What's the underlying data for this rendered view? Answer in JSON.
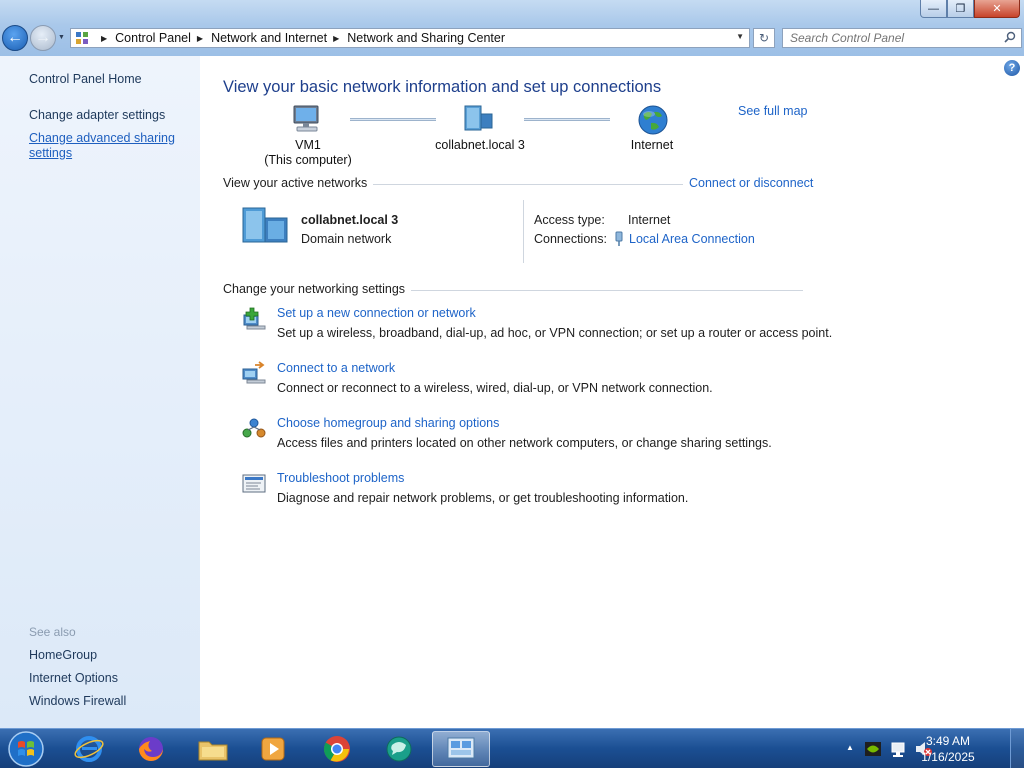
{
  "window": {
    "minimize_glyph": "—",
    "maximize_glyph": "❐",
    "close_glyph": "✕"
  },
  "toolbar": {
    "back_glyph": "←",
    "forward_glyph": "→",
    "breadcrumbs": [
      "Control Panel",
      "Network and Internet",
      "Network and Sharing Center"
    ],
    "refresh_glyph": "↻",
    "search_placeholder": "Search Control Panel"
  },
  "sidebar": {
    "home": "Control Panel Home",
    "adapter": "Change adapter settings",
    "advanced_line1": "Change advanced sharing",
    "advanced_line2": "settings",
    "see_also": "See also",
    "see_also_items": [
      "HomeGroup",
      "Internet Options",
      "Windows Firewall"
    ]
  },
  "main": {
    "help_glyph": "?",
    "title": "View your basic network information and set up connections",
    "map": {
      "computer_name": "VM1",
      "computer_sub": "(This computer)",
      "network_name": "collabnet.local  3",
      "internet_label": "Internet",
      "see_full_map": "See full map"
    },
    "active": {
      "header": "View your active networks",
      "connect_link": "Connect or disconnect",
      "network_name": "collabnet.local  3",
      "network_type": "Domain network",
      "access_type_label": "Access type:",
      "access_type_value": "Internet",
      "connections_label": "Connections:",
      "connections_value": "Local Area Connection"
    },
    "settings": {
      "header": "Change your networking settings",
      "tasks": [
        {
          "link": "Set up a new connection or network",
          "desc": "Set up a wireless, broadband, dial-up, ad hoc, or VPN connection; or set up a router or access point."
        },
        {
          "link": "Connect to a network",
          "desc": "Connect or reconnect to a wireless, wired, dial-up, or VPN network connection."
        },
        {
          "link": "Choose homegroup and sharing options",
          "desc": "Access files and printers located on other network computers, or change sharing settings."
        },
        {
          "link": "Troubleshoot problems",
          "desc": "Diagnose and repair network problems, or get troubleshooting information."
        }
      ]
    }
  },
  "taskbar": {
    "apps": [
      "internet-explorer",
      "firefox",
      "file-explorer",
      "media-player",
      "chrome",
      "messenger",
      "network-control-panel"
    ],
    "tray_arrow": "▲",
    "time": "3:49 AM",
    "date": "1/16/2025"
  },
  "colors": {
    "link": "#1e64c8",
    "title": "#1e3f8c",
    "sidebar_text": "#1e395b",
    "taskbar": "#1b4f93"
  }
}
